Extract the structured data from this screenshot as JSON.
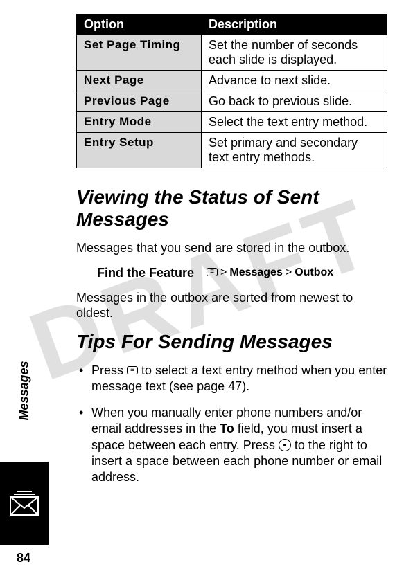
{
  "table": {
    "headers": {
      "option": "Option",
      "description": "Description"
    },
    "rows": [
      {
        "option": "Set Page Timing",
        "description": "Set the number of seconds each slide is displayed."
      },
      {
        "option": "Next Page",
        "description": "Advance to next slide."
      },
      {
        "option": "Previous Page",
        "description": "Go back to previous slide."
      },
      {
        "option": "Entry Mode",
        "description": "Select the text entry method."
      },
      {
        "option": "Entry Setup",
        "description": "Set primary and secondary text entry methods."
      }
    ]
  },
  "section1": {
    "title": "Viewing the Status of Sent Messages",
    "p1": "Messages that you send are stored in the outbox.",
    "feature_label": "Find the Feature",
    "path_gt1": ">",
    "path_item1": "Messages",
    "path_gt2": ">",
    "path_item2": "Outbox",
    "p2": "Messages in the outbox are sorted from newest to oldest."
  },
  "section2": {
    "title": "Tips For Sending Messages",
    "bullet1_a": "Press ",
    "bullet1_b": " to select a text entry method when you enter message text (see page 47).",
    "bullet2_a": "When you manually enter phone numbers and/or email addresses in the ",
    "bullet2_to": "To",
    "bullet2_b": " field, you must insert a space between each entry. Press ",
    "bullet2_c": " to the right to insert a space between each phone number or email address."
  },
  "side": {
    "label": "Messages"
  },
  "page_number": "84",
  "watermark": "DRAFT"
}
